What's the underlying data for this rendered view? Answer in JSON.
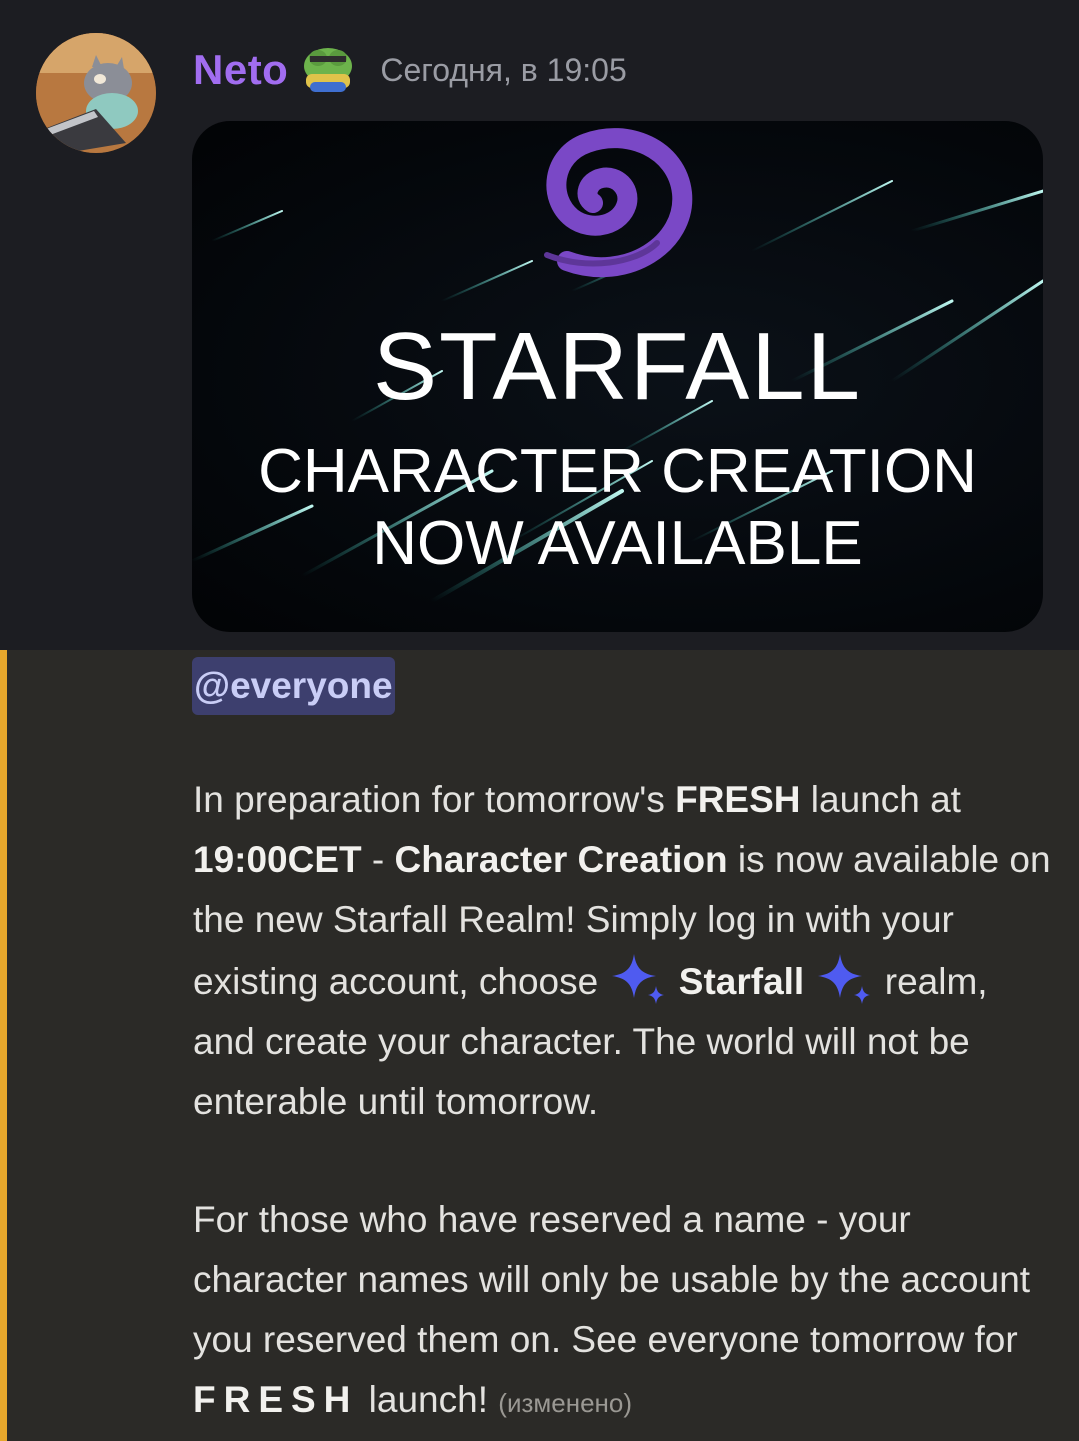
{
  "message": {
    "author": "Neto",
    "timestamp": "Сегодня, в 19:05",
    "author_color": "#a16df0",
    "badge_icon": "frog-emoji-icon",
    "avatar_icon": "cat-with-laptop-avatar",
    "mention_bar_color": "#e6a72c"
  },
  "banner": {
    "logo_icon": "purple-spiral-logo",
    "title": "STARFALL",
    "line1": "CHARACTER CREATION",
    "line2": "NOW AVAILABLE"
  },
  "mention": "@everyone",
  "body": {
    "p1_a": "In preparation for tomorrow's ",
    "p1_b": "FRESH",
    "p1_c": " launch at ",
    "p1_d": "19:00CET",
    "p1_e": " - ",
    "p1_f": "Character Creation",
    "p1_g": " is now available on the new Starfall Realm! Simply log in with your existing account, choose ",
    "p1_h": "Starfall",
    "p1_i": " realm, and create your character. The world will not be enterable until tomorrow.",
    "p2_a": "For those who have reserved a name - your character names will only be usable by the account you reserved them on. See everyone tomorrow for ",
    "p2_b": "FRESH",
    "p2_c": " launch! ",
    "edited": "(изменено)",
    "sparkle_icon": "sparkles-emoji-icon"
  }
}
